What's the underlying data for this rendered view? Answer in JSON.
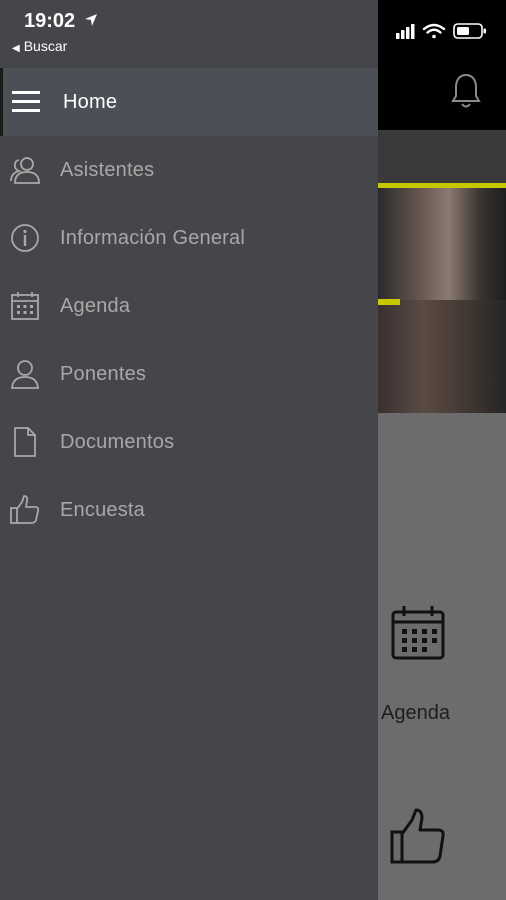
{
  "status_bar": {
    "time": "19:02",
    "back_label": "Buscar"
  },
  "menu": {
    "items": [
      {
        "label": "Home",
        "icon": "hamburger-icon"
      },
      {
        "label": "Asistentes",
        "icon": "people-icon"
      },
      {
        "label": "Información General",
        "icon": "info-icon"
      },
      {
        "label": "Agenda",
        "icon": "calendar-icon"
      },
      {
        "label": "Ponentes",
        "icon": "person-icon"
      },
      {
        "label": "Documentos",
        "icon": "document-icon"
      },
      {
        "label": "Encuesta",
        "icon": "thumbs-up-icon"
      }
    ],
    "active_index": 0
  },
  "background": {
    "agenda_label": "Agenda"
  },
  "colors": {
    "drawer": "#454649",
    "active_row": "#4c4f55",
    "accent": "#c8c800",
    "inactive_text": "#a8a8a8"
  }
}
